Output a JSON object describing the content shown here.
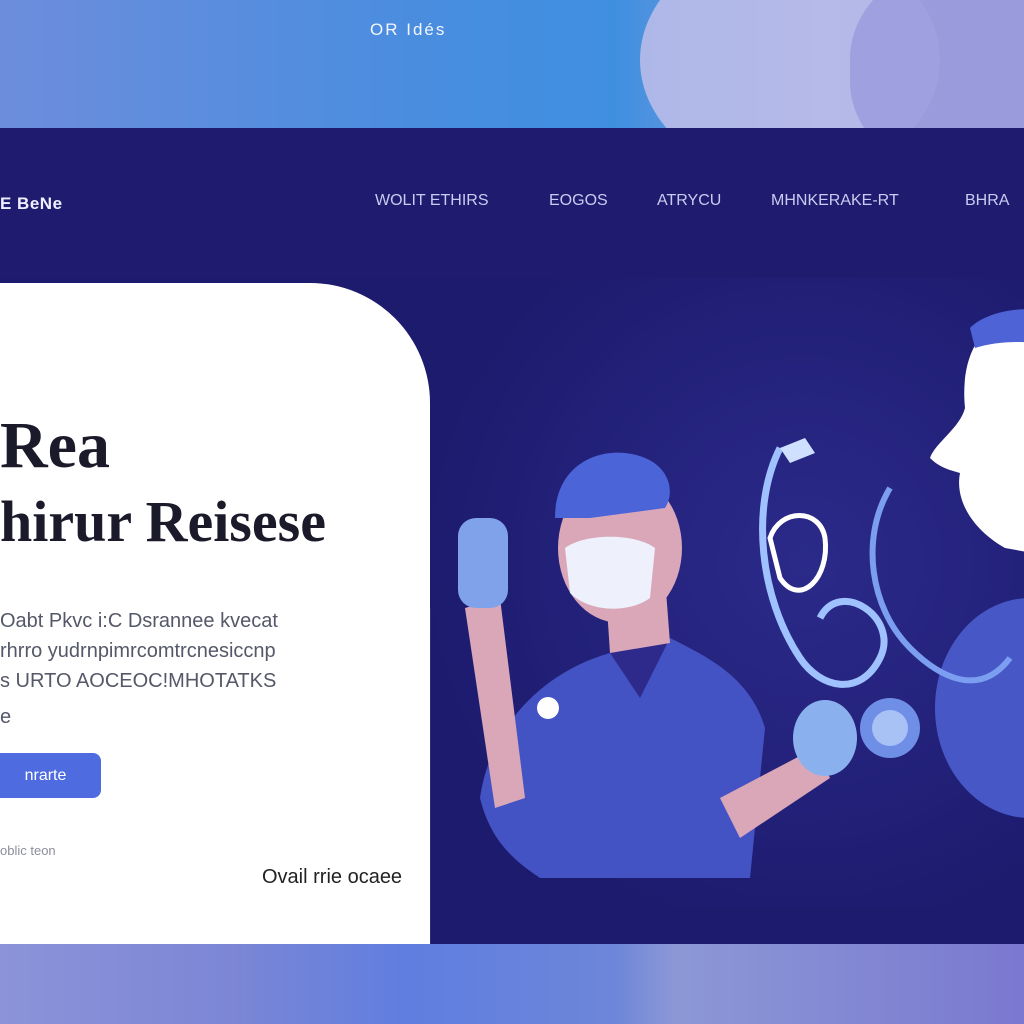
{
  "window": {
    "title": "OR Idés"
  },
  "nav": {
    "brand": "E BeNe",
    "links": [
      "WOLIT ETHIRS",
      "EOGOS",
      "ATRYCU",
      "MHNKERAKE-RT",
      "BHRA"
    ]
  },
  "hero": {
    "headline_line1": "Rea",
    "headline_line2": "hirur Reisese",
    "description": [
      "Oabt Pkvc i:C Dsrannee kvecat",
      "rhrro yudrnpimrcomtrcnesiccnp",
      "s URTO AOCEOC!MHOTATKS"
    ],
    "description_tail": "e",
    "cta_label": "nrarte",
    "small_link": "oblic teon",
    "scroll_label": "Ovail rrie ocaee"
  },
  "colors": {
    "nav_bg": "#1f1c70",
    "accent": "#4e6ce0",
    "hero_bg": "#ffffff",
    "illustration_bg": "#1d1b6e"
  }
}
